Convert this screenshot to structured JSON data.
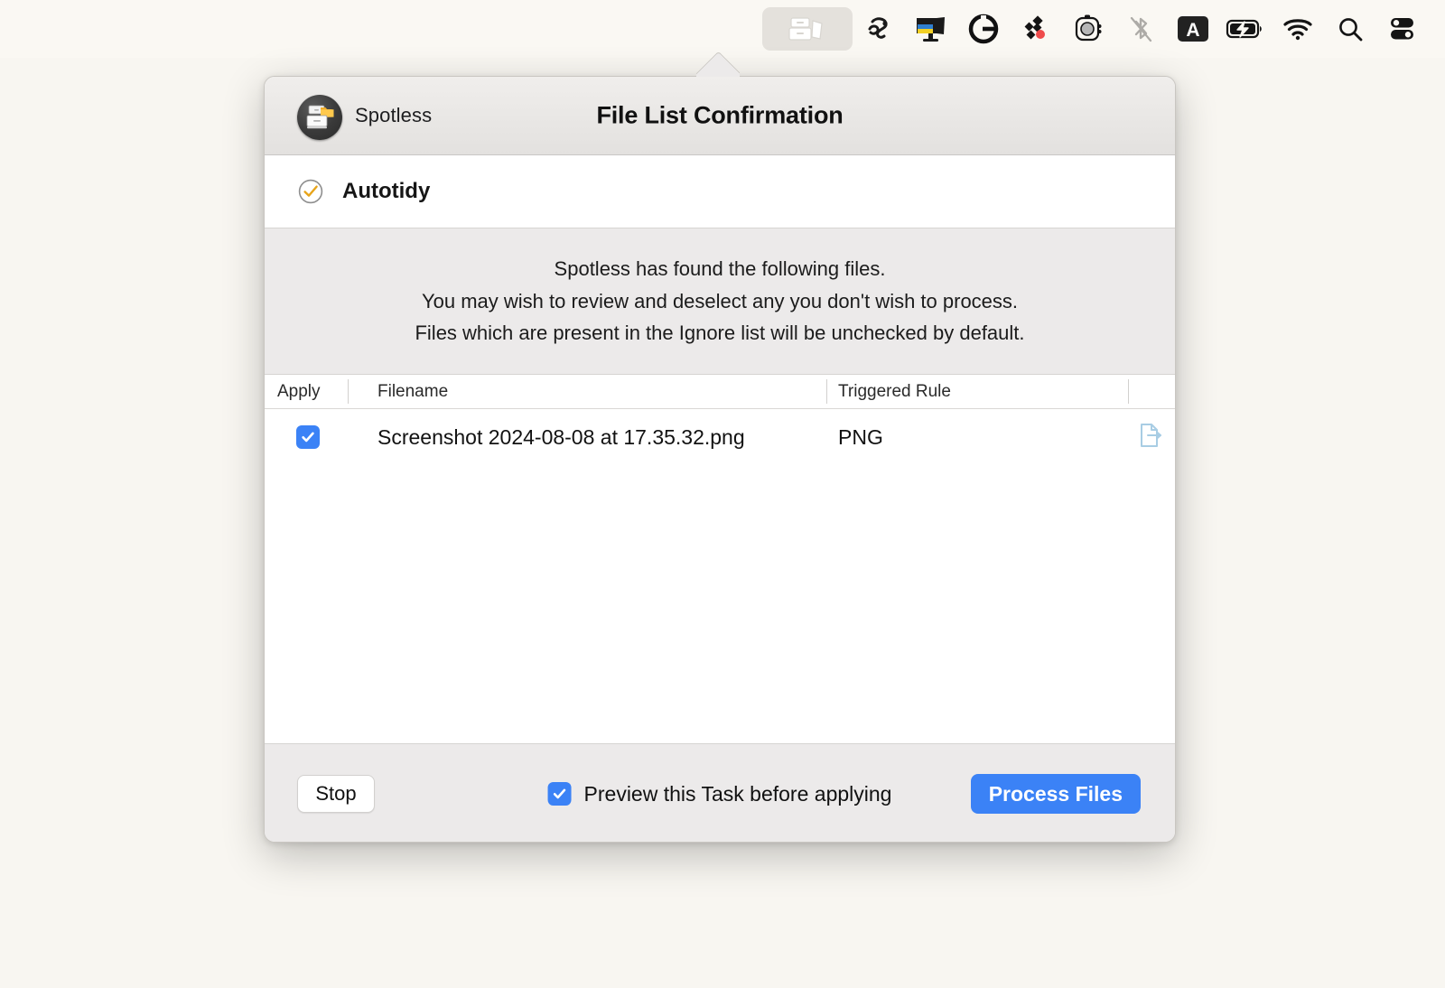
{
  "menubar": {
    "items": [
      {
        "name": "spotless-menu-item",
        "icon": "filing-cabinet-icon",
        "active": true
      },
      {
        "name": "cleanmymac-menu-item",
        "icon": "swirl-brush-icon",
        "active": false
      },
      {
        "name": "displaymate-menu-item",
        "icon": "monitor-flag-icon",
        "active": false
      },
      {
        "name": "grammarly-menu-item",
        "icon": "grammarly-g-icon",
        "active": false
      },
      {
        "name": "dropbox-menu-item",
        "icon": "diamond-cluster-icon",
        "active": false
      },
      {
        "name": "camera-menu-item",
        "icon": "camera-icon",
        "active": false
      },
      {
        "name": "bluetooth-menu-item",
        "icon": "bluetooth-off-icon",
        "active": false
      },
      {
        "name": "input-source-menu-item",
        "icon": "letter-a-icon",
        "active": false,
        "label": "A"
      },
      {
        "name": "battery-menu-item",
        "icon": "battery-charging-icon",
        "active": false
      },
      {
        "name": "wifi-menu-item",
        "icon": "wifi-icon",
        "active": false
      },
      {
        "name": "spotlight-menu-item",
        "icon": "search-icon",
        "active": false
      },
      {
        "name": "control-center-menu-item",
        "icon": "control-center-icon",
        "active": false
      }
    ]
  },
  "dialog": {
    "app_name": "Spotless",
    "title": "File List Confirmation",
    "app_icon": "filing-cabinet-folder-icon",
    "task": {
      "label": "Autotidy",
      "status_icon": "check-circle-icon",
      "checked": true
    },
    "description": {
      "line1": "Spotless has found the following files.",
      "line2": "You may wish to review and deselect any you don't wish to process.",
      "line3": "Files which are present in the Ignore list will be unchecked by default."
    },
    "table": {
      "columns": [
        {
          "key": "apply",
          "label": "Apply"
        },
        {
          "key": "name",
          "label": "Filename"
        },
        {
          "key": "rule",
          "label": "Triggered Rule"
        },
        {
          "key": "action",
          "label": ""
        }
      ],
      "rows": [
        {
          "apply": true,
          "name": "Screenshot 2024-08-08 at 17.35.32.png",
          "rule": "PNG",
          "action_icon": "reveal-file-icon"
        }
      ]
    },
    "footer": {
      "stop_label": "Stop",
      "preview_label": "Preview this Task before applying",
      "preview_checked": true,
      "process_label": "Process Files"
    }
  },
  "colors": {
    "accent_blue": "#3b82f6",
    "check_gold": "#e8a419",
    "reveal_icon_blue": "#a8cde4",
    "desktop_background": "#f8f6f1",
    "menubar_background": "#faf8f3",
    "panel_gray": "#eceaea"
  }
}
